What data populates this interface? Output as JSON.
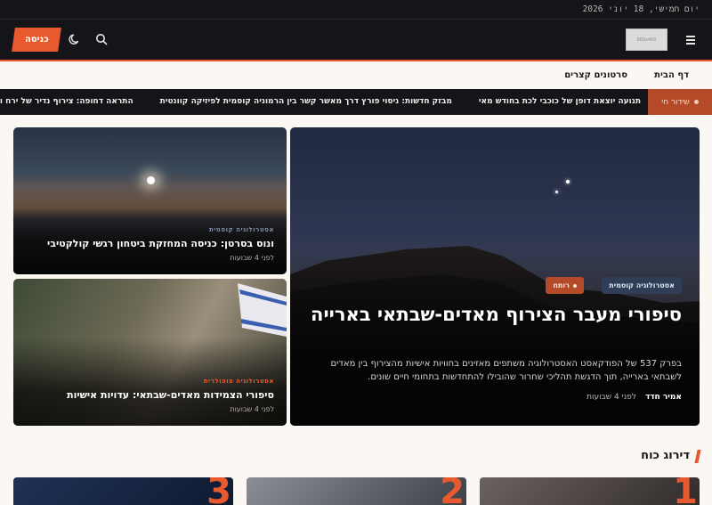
{
  "topbar": {
    "date": "יום חמישי, 18 יוני 2026"
  },
  "header": {
    "logo_text": "000x400",
    "login_label": "כניסה"
  },
  "nav": {
    "items": [
      "דף הבית",
      "סרטונים קצרים"
    ]
  },
  "ticker": {
    "label": "שידור חי",
    "items": [
      "תנועה יוצאת דופן של כוכבי לכת בחודש מאי",
      "מבזק חדשות: ניסוי פורץ דרך מאשר קשר בין הרמוניה קוסמית לפיזיקה קוונטית",
      "התראה דחופה: צירוף נדיר של ירח וכ"
    ]
  },
  "featured": {
    "category": "אסטרולוגיה קוסמית",
    "hot_label": "רותח",
    "title": "סיפורי מעבר הצירוף מאדים-שבתאי בארייה",
    "excerpt": "בפרק 537 של הפודקאסט האסטרולוגיה משתפים מאזינים בחוויות אישיות מהצירוף בין מאדים לשבתאי בארייה, תוך הדגשת תהליכי שחרור שהובילו להתחדשות בתחומי חיים שונים.",
    "author": "אמיר חדד",
    "time": "לפני 4 שבועות"
  },
  "side_articles": [
    {
      "category": "אסטרולוגיה קוסמית",
      "title": "ונוס בסרטן: כניסה המחזקת ביטחון רגשי קולקטיבי",
      "time": "לפני 4 שבועות"
    },
    {
      "category": "אסטרולוגיה פופולרית",
      "title": "סיפורי הצמידות מאדים-שבתאי: עדויות אישיות",
      "time": "לפני 4 שבועות"
    }
  ],
  "section": {
    "title": "דירוג כוח",
    "ranks": [
      "1",
      "2",
      "3"
    ]
  },
  "colors": {
    "accent": "#e8592e",
    "dark": "#141419",
    "background": "#fbf7f3"
  }
}
